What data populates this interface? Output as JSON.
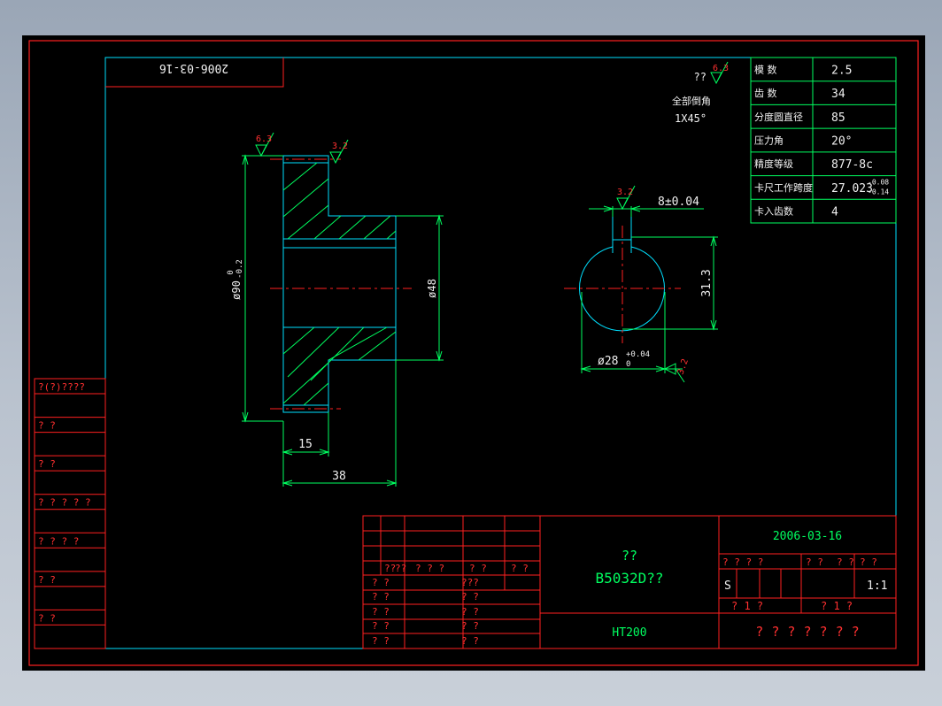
{
  "drawing": {
    "date_rotated": "2006-03-16",
    "tech_note": {
      "roughness_prefix": "??",
      "roughness_value": "6.3",
      "line1": "全部倒角",
      "line2": "1X45°"
    },
    "params": [
      {
        "label": "模  数",
        "value": "2.5"
      },
      {
        "label": "齿  数",
        "value": "34"
      },
      {
        "label": "分度圆直径",
        "value": "85"
      },
      {
        "label": "压力角",
        "value": "20°"
      },
      {
        "label": "精度等级",
        "value": "877-8c"
      },
      {
        "label": "卡尺工作跨度",
        "value": "27.023",
        "sup": "-0.08",
        "sub": "-0.14"
      },
      {
        "label": "卡入齿数",
        "value": "4"
      }
    ],
    "side_view": {
      "roughness_outer": "6.3",
      "roughness_face": "3.2",
      "dim_outer_dia": "ø90",
      "dim_outer_dia_sup": "0",
      "dim_outer_dia_sub": "-0.2",
      "dim_hub_dia": "ø48",
      "dim_width": "15",
      "dim_total": "38"
    },
    "bore_view": {
      "roughness_key": "3.2",
      "roughness_bore": "3.2",
      "dim_key_width": "8±0.04",
      "dim_key_depth": "31.3",
      "dim_bore": "ø28",
      "dim_bore_sup": "+0.04",
      "dim_bore_sub": "0"
    },
    "left_strip": [
      "?(?)????",
      "?    ?",
      "?    ?",
      "? ? ? ? ?",
      "? ? ? ?",
      "?    ?",
      "?    ?"
    ],
    "title_block": {
      "header_cells": [
        "??",
        "??",
        "? ? ?",
        "?  ?",
        "?  ?"
      ],
      "rows_left": [
        "? ?",
        "? ?",
        "? ?",
        "? ?",
        "? ?"
      ],
      "rows_mid": [
        "???",
        "? ?",
        "? ?",
        "? ?",
        "? ?"
      ],
      "part_label": "??",
      "part_number": "B5032D??",
      "material": "HT200",
      "date": "2006-03-16",
      "stage_headers": [
        "? ? ? ?",
        "? ?",
        "? ?",
        "? ?"
      ],
      "stage_mark": "S",
      "scale": "1:1",
      "sheet_left": "?   1   ?",
      "sheet_right": "?   1   ?",
      "company": "? ? ? ? ? ? ?"
    }
  }
}
